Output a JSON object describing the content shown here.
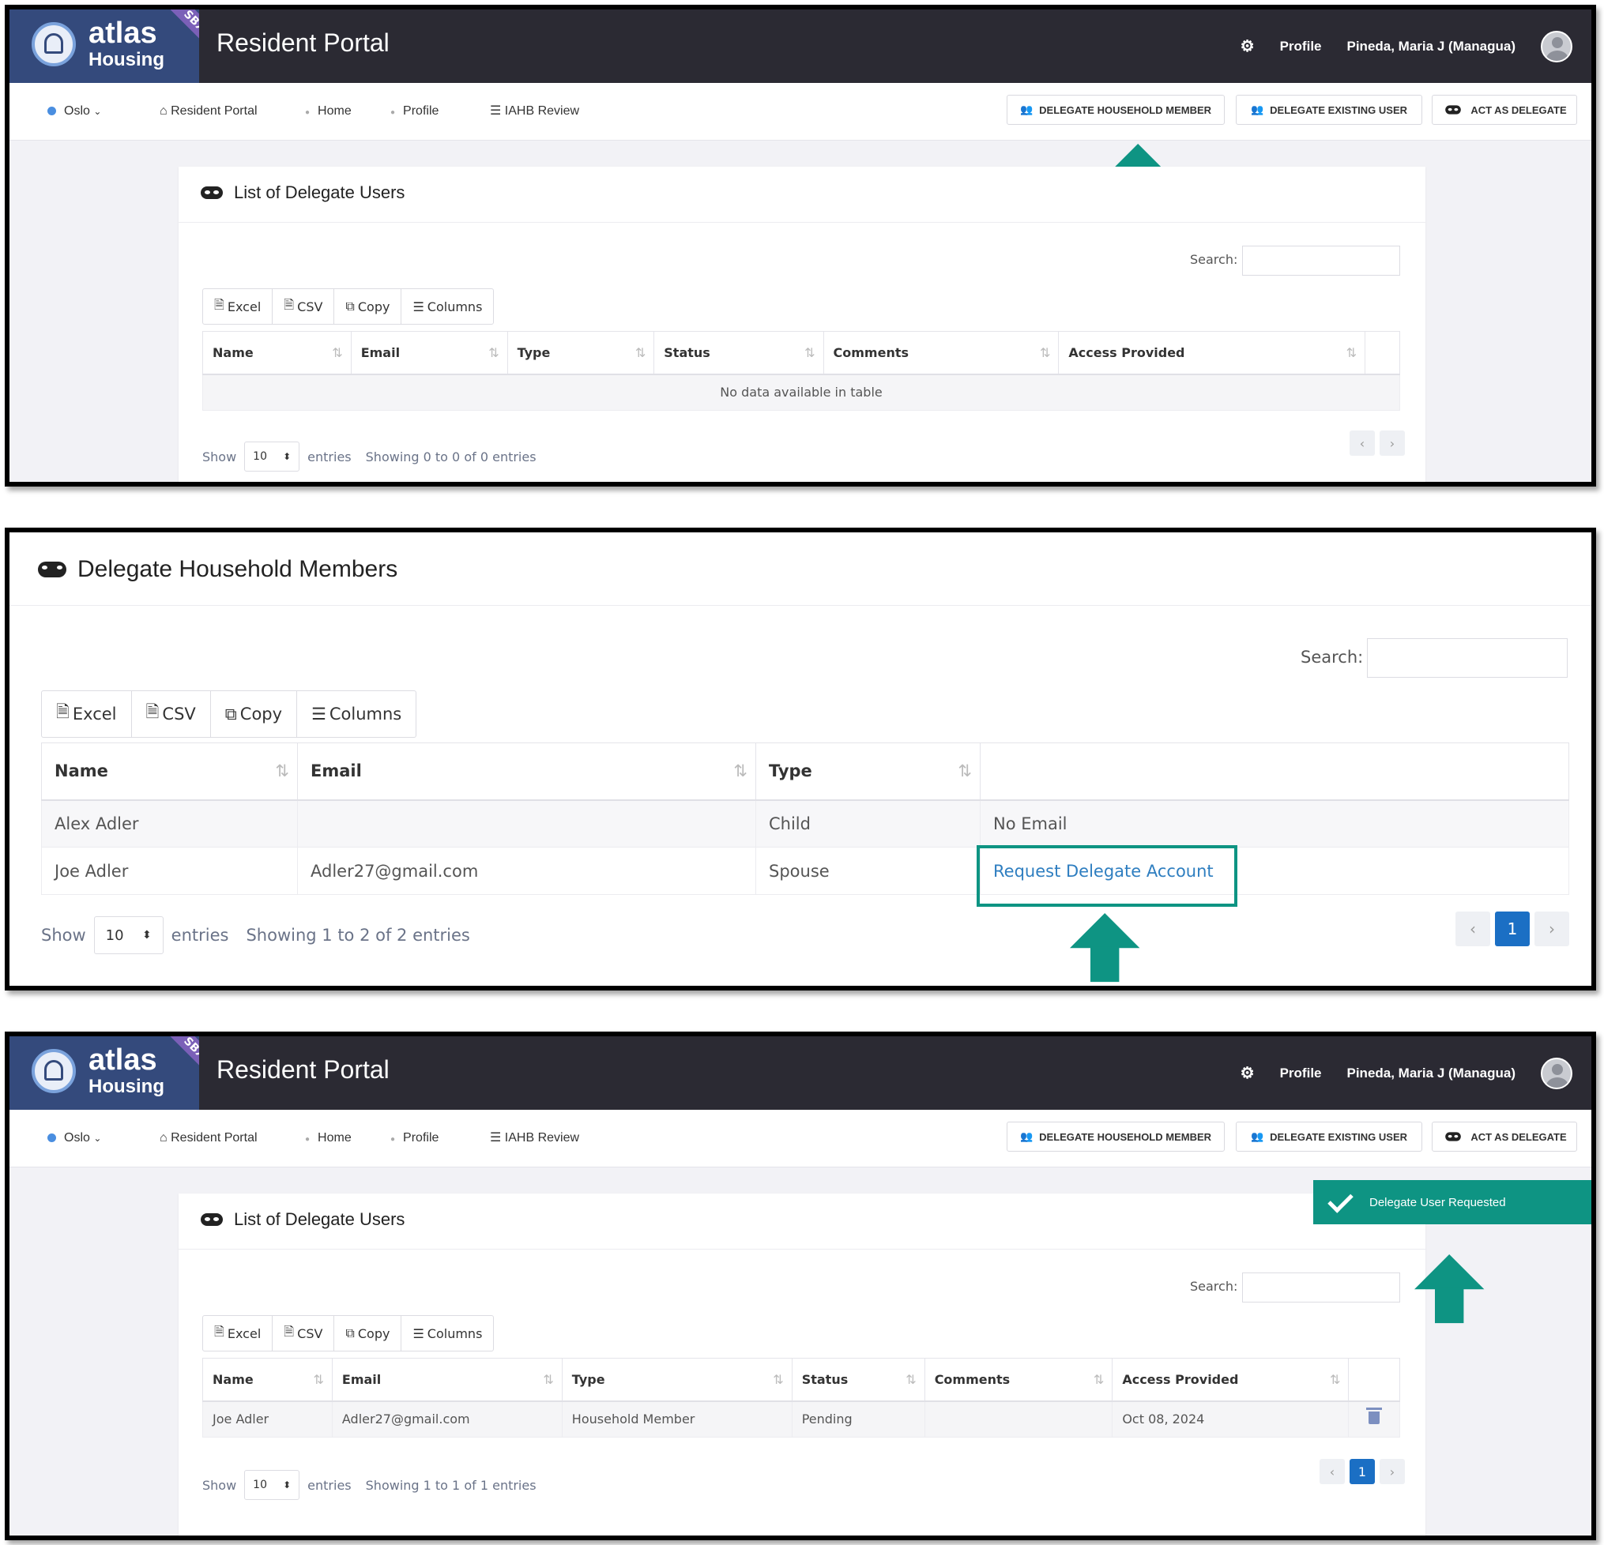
{
  "header": {
    "logo_word": "atlas",
    "logo_sub": "Housing",
    "sandbox_badge": "SBX",
    "app_title": "Resident Portal",
    "settings_icon": "gear-icon",
    "profile_label": "Profile",
    "user_name": "Pineda, Maria J (Managua)"
  },
  "nav": {
    "location": "Oslo",
    "items": [
      "Resident Portal",
      "Home",
      "Profile",
      "IAHB Review"
    ],
    "buttons": {
      "delegate_household_member": "DELEGATE HOUSEHOLD MEMBER",
      "delegate_existing_user": "DELEGATE EXISTING USER",
      "act_as_delegate": "ACT AS DELEGATE"
    }
  },
  "panel1": {
    "card_title": "List of Delegate Users",
    "search_label": "Search:",
    "export_buttons": [
      "Excel",
      "CSV",
      "Copy",
      "Columns"
    ],
    "columns": [
      "Name",
      "Email",
      "Type",
      "Status",
      "Comments",
      "Access Provided"
    ],
    "empty_message": "No data available in table",
    "show_label": "Show",
    "page_size": "10",
    "entries_label": "entries",
    "info": "Showing 0 to 0 of 0 entries"
  },
  "panel2": {
    "card_title": "Delegate Household Members",
    "search_label": "Search:",
    "export_buttons": [
      "Excel",
      "CSV",
      "Copy",
      "Columns"
    ],
    "columns": [
      "Name",
      "Email",
      "Type"
    ],
    "rows": [
      {
        "name": "Alex Adler",
        "email": "",
        "type": "Child",
        "action": "No Email"
      },
      {
        "name": "Joe Adler",
        "email": "Adler27@gmail.com",
        "type": "Spouse",
        "action": "Request Delegate Account"
      }
    ],
    "show_label": "Show",
    "page_size": "10",
    "entries_label": "entries",
    "info": "Showing 1 to 2 of 2 entries",
    "current_page": "1"
  },
  "panel3": {
    "card_title": "List of Delegate Users",
    "toast_message": "Delegate User Requested",
    "search_label": "Search:",
    "export_buttons": [
      "Excel",
      "CSV",
      "Copy",
      "Columns"
    ],
    "columns": [
      "Name",
      "Email",
      "Type",
      "Status",
      "Comments",
      "Access Provided"
    ],
    "rows": [
      {
        "name": "Joe Adler",
        "email": "Adler27@gmail.com",
        "type": "Household Member",
        "status": "Pending",
        "comments": "",
        "access_provided": "Oct 08, 2024"
      }
    ],
    "show_label": "Show",
    "page_size": "10",
    "entries_label": "entries",
    "info": "Showing 1 to 1 of 1 entries",
    "current_page": "1"
  },
  "colors": {
    "header_bg": "#2b2a33",
    "accent_teal": "#0e9483",
    "link_blue": "#2e7ec0",
    "pager_active": "#1b6fc4"
  }
}
